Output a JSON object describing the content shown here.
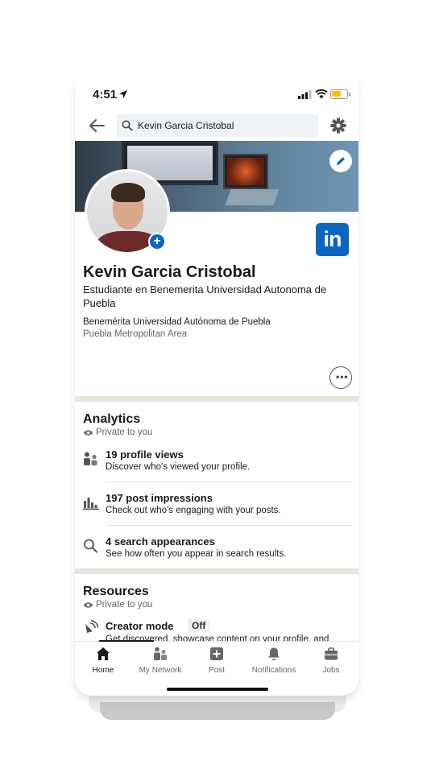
{
  "status_bar": {
    "time": "4:51"
  },
  "search": {
    "query": "Kevin Garcia Cristobal"
  },
  "profile": {
    "name": "Kevin Garcia Cristobal",
    "headline": "Estudiante en Benemerita Universidad Autonoma de Puebla",
    "education": "Benemérita Universidad Autónoma de Puebla",
    "location": "Puebla Metropolitan Area"
  },
  "logo": {
    "text": "in",
    "color": "#0a66c2"
  },
  "analytics": {
    "title": "Analytics",
    "private_label": "Private to you",
    "items": [
      {
        "icon": "people-icon",
        "title": "19 profile views",
        "subtitle": "Discover who's viewed your profile."
      },
      {
        "icon": "bar-chart-icon",
        "title": "197 post impressions",
        "subtitle": "Check out who's engaging with your posts."
      },
      {
        "icon": "search-icon",
        "title": "4 search appearances",
        "subtitle": "See how often you appear in search results."
      }
    ]
  },
  "resources": {
    "title": "Resources",
    "private_label": "Private to you",
    "creator_mode": {
      "title": "Creator mode",
      "badge": "Off",
      "subtitle": "Get discovered, showcase content on your profile, and"
    }
  },
  "bottom_nav": {
    "items": [
      {
        "label": "Home",
        "icon": "home-icon",
        "active": true
      },
      {
        "label": "My Network",
        "icon": "network-icon",
        "active": false
      },
      {
        "label": "Post",
        "icon": "post-icon",
        "active": false
      },
      {
        "label": "Notifications",
        "icon": "bell-icon",
        "active": false
      },
      {
        "label": "Jobs",
        "icon": "briefcase-icon",
        "active": false
      }
    ]
  },
  "colors": {
    "brand": "#0a66c2",
    "section_divider": "#e9e5df",
    "search_bg": "#eef3f8"
  }
}
